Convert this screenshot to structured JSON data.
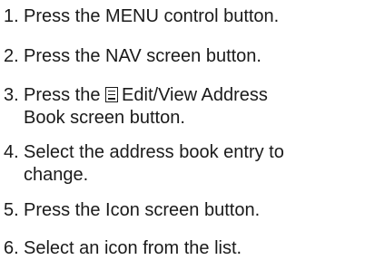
{
  "steps": [
    {
      "number": "1.",
      "text": "Press the MENU control button."
    },
    {
      "number": "2.",
      "text": "Press the NAV screen button."
    },
    {
      "number": "3.",
      "text_before_icon": "Press the",
      "icon": "address-book-icon",
      "text_after_icon": "Edit/View Address",
      "text_line2": "Book screen button."
    },
    {
      "number": "4.",
      "text": "Select the address book entry to",
      "text_line2": "change."
    },
    {
      "number": "5.",
      "text": "Press the Icon screen button."
    },
    {
      "number": "6.",
      "text": "Select an icon from the list."
    }
  ]
}
